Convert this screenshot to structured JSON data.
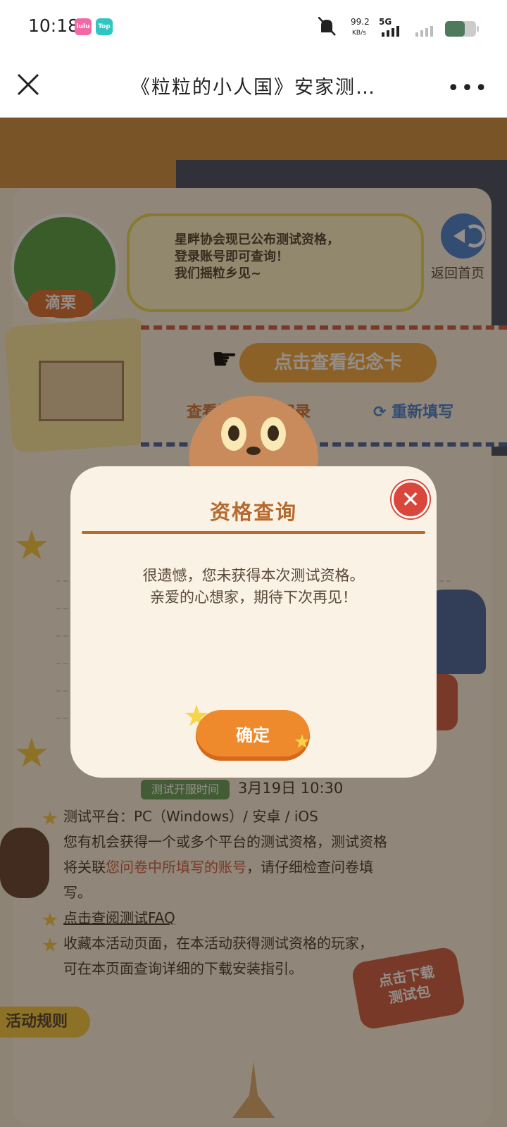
{
  "status_bar": {
    "time": "10:18",
    "app_icons": [
      "lulu",
      "Top"
    ],
    "net_speed_value": "99.2",
    "net_speed_unit": "KB/s",
    "network_type": "5G",
    "battery_icon": "battery-icon",
    "bell_icon": "bell-muted-icon"
  },
  "navbar": {
    "title": "《粒粒的小人国》安家测…",
    "close_icon": "close-icon",
    "more_icon": "more-icon"
  },
  "page": {
    "npc_name": "滴栗",
    "speech_lines": [
      "星畔协会现已公布测试资格，",
      "登录账号即可查询！",
      "我们摇粒乡见~"
    ],
    "home_label": "返回首页",
    "memo_button": "点击查看纪念卡",
    "view_record_link": "查看问卷填写记录",
    "refill_link": "重新填写",
    "test_time_badge": "测试开服时间",
    "test_time_value": "3月19日  10:30",
    "platform_line": "测试平台：PC（Windows）/ 安卓 / iOS",
    "qualification_line_1": "您有机会获得一个或多个平台的测试资格，测试资格",
    "qualification_line_2_prefix": "将关联",
    "qualification_line_2_highlight": "您问卷中所填写的账号",
    "qualification_line_2_suffix": "，请仔细检查问卷填",
    "qualification_line_3": "写。",
    "faq_link": "点击查阅测试FAQ",
    "favorite_line_1": "收藏本活动页面，在本活动获得测试资格的玩家，",
    "favorite_line_2": "可在本页面查询详细的下载安装指引。",
    "download_tag": "点击下载\n测试包",
    "rules_tag": "活动规则"
  },
  "modal": {
    "title": "资格查询",
    "message_line_1": "很遗憾，您未获得本次测试资格。",
    "message_line_2": "亲爱的心想家，期待下次再见！",
    "ok_button": "确定",
    "close_icon": "close-icon"
  },
  "colors": {
    "modal_bg": "#fbf2e6",
    "title_brown": "#b56a2e",
    "ok_orange": "#ee8a2c",
    "close_red": "#d9473c",
    "badge_green": "#5e9a58"
  }
}
